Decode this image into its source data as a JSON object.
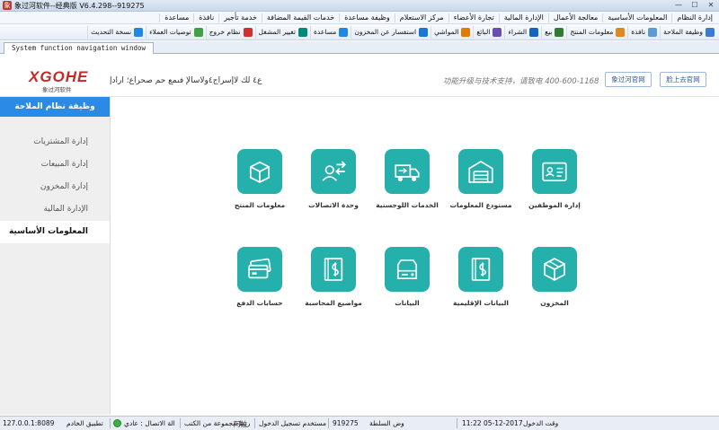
{
  "window": {
    "title": "象过河软件--经典版 V6.4.298--919275",
    "app_icon_glyph": "象",
    "controls": [
      "—",
      "☐",
      "✕"
    ]
  },
  "menu": [
    "إدارة النظام",
    "المعلومات الأساسية",
    "معالجة الأعمال",
    "الإدارة المالية",
    "تجارة الأعضاء",
    "مركز الاستعلام",
    "وظيفة مساعدة",
    "خدمات القيمة المضافة",
    "خدمة تأجير",
    "نافذة",
    "مساعدة"
  ],
  "toolbar": [
    {
      "label": "وظيفة الملاحة",
      "icon": "navigation-icon",
      "color": "#3a7bd5"
    },
    {
      "label": "نافذة",
      "icon": "window-icon",
      "color": "#5b9bd5"
    },
    {
      "label": "معلومات المنتج",
      "icon": "product-icon",
      "color": "#e08a1e"
    },
    {
      "label": "بيع",
      "icon": "sale-icon",
      "color": "#2e7d32"
    },
    {
      "label": "الشراء",
      "icon": "purchase-icon",
      "color": "#1565c0"
    },
    {
      "label": "البائع",
      "icon": "vendor-icon",
      "color": "#6a4fb3"
    },
    {
      "label": "المواشي",
      "icon": "stock-icon",
      "color": "#e07b00"
    },
    {
      "label": "استفسار عن المخزون",
      "icon": "inventory-query-icon",
      "color": "#1976d2"
    },
    {
      "label": "مساعدة",
      "icon": "help-icon",
      "color": "#1e88e5"
    },
    {
      "label": "تغيير المشغل",
      "icon": "switch-operator-icon",
      "color": "#00897b"
    },
    {
      "label": "نظام خروج",
      "icon": "exit-icon",
      "color": "#d32f2f"
    },
    {
      "label": "توصيات العملاء",
      "icon": "customer-recommend-icon",
      "color": "#43a047"
    },
    {
      "label": "نسخة التحديث",
      "icon": "update-icon",
      "color": "#1e88e5"
    }
  ],
  "tab": {
    "label": "System function navigation window"
  },
  "header": {
    "logo": "XGOHE",
    "logo_sub": "象过河软件",
    "garbled_title": "ع٤ لك لاإسراج٤ولاسالإ فىمع حم صحراع؛ ارادإ",
    "support": "功能升级与技术支持，请致电 400-600-1168",
    "site_button": "象过河官网",
    "forum_button": "脸上去官网"
  },
  "sidebar": {
    "heading": "وظيفة نظام الملاحة",
    "items": [
      {
        "label": "إدارة المشتريات",
        "active": false
      },
      {
        "label": "إدارة المبيعات",
        "active": false
      },
      {
        "label": "إدارة المخزون",
        "active": false
      },
      {
        "label": "الإدارة المالية",
        "active": false
      },
      {
        "label": "المعلومات الأساسية",
        "active": true
      }
    ]
  },
  "modules": [
    {
      "label": "معلومات المنتج",
      "icon": "box-icon"
    },
    {
      "label": "وحدة الاتصالات",
      "icon": "contacts-exchange-icon"
    },
    {
      "label": "الخدمات اللوجستية",
      "icon": "truck-icon"
    },
    {
      "label": "مستودع المعلومات",
      "icon": "warehouse-icon"
    },
    {
      "label": "إدارة الموظفين",
      "icon": "id-card-icon"
    },
    {
      "label": "حسابات الدفع",
      "icon": "payment-cards-icon"
    },
    {
      "label": "مواضيع المحاسبة",
      "icon": "accounting-book-icon"
    },
    {
      "label": "البيانات",
      "icon": "data-drive-icon"
    },
    {
      "label": "البيانات الإقليمية",
      "icon": "regional-book-icon"
    },
    {
      "label": "المخزون",
      "icon": "cube-icon"
    }
  ],
  "status": {
    "server": "127.0.0.1:8089",
    "app_label": "تطبيق الخادم",
    "connection": "الة الاتصال : عادي",
    "group": "ربط  مجموعة من الكتب",
    "company": "阿拉",
    "login_user": "مستخدم تسجيل الدخول",
    "authority": "919275",
    "authority_label": "وض السلطة",
    "time": "11:22 05-12-2017",
    "time_label": "وقت الدخول"
  }
}
